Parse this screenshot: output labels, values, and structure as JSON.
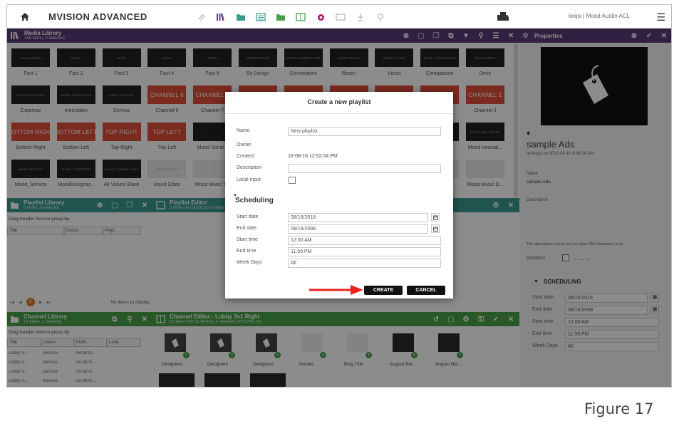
{
  "app": {
    "title": "MVISION ADVANCED",
    "user": "leejsi | Mood Austin ACL"
  },
  "media_library": {
    "title": "Media Library",
    "subtitle": "185 items, 0 selected",
    "rows": [
      [
        {
          "label": "Fact 1",
          "tile": "MOOD MEDIA",
          "style": "dark"
        },
        {
          "label": "Fact 2",
          "tile": "MOOD",
          "style": "dark"
        },
        {
          "label": "Fact 3",
          "tile": "MOOD",
          "style": "dark"
        },
        {
          "label": "Fact 4",
          "tile": "MOOD",
          "style": "dark"
        },
        {
          "label": "Fact 5",
          "tile": "MOOD",
          "style": "dark"
        },
        {
          "label": "By Design",
          "tile": "MOOD DESIGN",
          "style": "dark"
        },
        {
          "label": "Connections",
          "tile": "MOOD CONNECTIONS",
          "style": "dark"
        },
        {
          "label": "Reach",
          "tile": "MOOD REACH",
          "style": "dark"
        },
        {
          "label": "Vision",
          "tile": "MOOD VISION",
          "style": "dark"
        },
        {
          "label": "Compassion",
          "tile": "MOOD COMPASSION",
          "style": "dark"
        },
        {
          "label": "Drive",
          "tile": "MOOD DRIVE",
          "style": "dark"
        }
      ],
      [
        {
          "label": "Expertise",
          "tile": "MOOD EXPERTISE",
          "style": "dark"
        },
        {
          "label": "Innovation",
          "tile": "MOOD INNOVATION",
          "style": "dark"
        },
        {
          "label": "Service",
          "tile": "MOOD SERVICE",
          "style": "dark"
        },
        {
          "label": "Channel-6",
          "tile": "CHANNEL 6",
          "style": "red"
        },
        {
          "label": "Channel-7",
          "tile": "CHANNEL 7",
          "style": "red"
        },
        {
          "label": "",
          "tile": "",
          "style": "red"
        },
        {
          "label": "",
          "tile": "",
          "style": "red"
        },
        {
          "label": "",
          "tile": "",
          "style": "red"
        },
        {
          "label": "",
          "tile": "",
          "style": "red"
        },
        {
          "label": "",
          "tile": "",
          "style": "red"
        },
        {
          "label": "Channel-1",
          "tile": "CHANNEL 1",
          "style": "red"
        }
      ],
      [
        {
          "label": "Bottom-Right",
          "tile": "BOTTOM RIGHT",
          "style": "red"
        },
        {
          "label": "Bottom-Left",
          "tile": "BOTTOM LEFT",
          "style": "red"
        },
        {
          "label": "Top-Right",
          "tile": "TOP RIGHT",
          "style": "red"
        },
        {
          "label": "Top-Left",
          "tile": "TOP LEFT",
          "style": "red"
        },
        {
          "label": "Mood Soluti...",
          "tile": "",
          "style": "dark"
        },
        {
          "label": "",
          "tile": "",
          "style": "dark"
        },
        {
          "label": "",
          "tile": "",
          "style": "dark"
        },
        {
          "label": "",
          "tile": "",
          "style": "dark"
        },
        {
          "label": "",
          "tile": "",
          "style": "dark"
        },
        {
          "label": "",
          "tile": "",
          "style": "dark"
        },
        {
          "label": "Mood Innovat...",
          "tile": "MOOD INNOVATION",
          "style": "dark"
        }
      ],
      [
        {
          "label": "Mood_Service",
          "tile": "MOOD SERVICE",
          "style": "dark"
        },
        {
          "label": "MoodDesigner...",
          "tile": "MOOD EXPERTISE",
          "style": "dark"
        },
        {
          "label": "All Values Black",
          "tile": "MOOD CONNECTIONS",
          "style": "dark"
        },
        {
          "label": "Mood Cities",
          "tile": "MOOD CITIES",
          "style": "dim"
        },
        {
          "label": "Mood Music T...",
          "tile": "",
          "style": "dim"
        },
        {
          "label": "",
          "tile": "",
          "style": "dim"
        },
        {
          "label": "",
          "tile": "",
          "style": "dim"
        },
        {
          "label": "",
          "tile": "",
          "style": "dim"
        },
        {
          "label": "",
          "tile": "",
          "style": "dim"
        },
        {
          "label": "",
          "tile": "",
          "style": "dim"
        },
        {
          "label": "Mood Music D...",
          "tile": "",
          "style": "dim"
        }
      ]
    ]
  },
  "playlist_library": {
    "title": "Playlist Library",
    "subtitle": "0 items, 0 selected",
    "group_hint": "Drag header here to group by",
    "columns": [
      "Title",
      "Descri...",
      "Playl..."
    ],
    "page": "0",
    "empty": "No items to display"
  },
  "playlist_editor": {
    "title": "Playlist Editor",
    "subtitle": "0 items (00:00:00.00) 0 selected"
  },
  "channel_library": {
    "title": "Channel Library",
    "subtitle": "14 items, 1 selected",
    "group_hint": "Drag header here to group by",
    "columns": [
      "Title",
      "Owner",
      "Publi...",
      "Lock..."
    ],
    "rows": [
      [
        "Lobby V...",
        "joehuse",
        "05/18/20...",
        ""
      ],
      [
        "Lobby V...",
        "joehuse",
        "05/18/20...",
        ""
      ],
      [
        "Lobby V...",
        "joehuse",
        "05/18/20...",
        ""
      ],
      [
        "Lobby V...",
        "mahuse",
        "05/18/20...",
        ""
      ]
    ]
  },
  "channel_editor": {
    "title": "Channel Editor - Lobby 3v1 Right",
    "subtitle": "10 items (00:01:48.443) 0 selected (00:00:00.00)",
    "items": [
      {
        "label": "Designers",
        "badge": "1"
      },
      {
        "label": "Designers",
        "badge": "2"
      },
      {
        "label": "Designers",
        "badge": "3"
      },
      {
        "label": "Socials",
        "badge": "4"
      },
      {
        "label": "Blog Title",
        "badge": "5"
      },
      {
        "label": "August Bet...",
        "badge": "6"
      },
      {
        "label": "August Bet...",
        "badge": "7"
      }
    ]
  },
  "properties": {
    "title": "Properties",
    "name": "sample Ads",
    "byline": "by leejsi on 2016-08-16 4:36:34 PM",
    "name_label": "Name",
    "name_value": "sample Ads",
    "desc_label": "Description",
    "desc_hint": "The description has to be less than 255 characters long",
    "duration_label": "Duration",
    "duration_value": "_ : _ : _",
    "scheduling_label": "SCHEDULING",
    "start_date_label": "Start date",
    "start_date": "08/16/2016",
    "end_date_label": "End date",
    "end_date": "08/16/2099",
    "start_time_label": "Start time",
    "start_time": "12:00 AM",
    "end_time_label": "End time",
    "end_time": "11:59 PM",
    "week_days_label": "Week Days",
    "week_days": "All"
  },
  "modal": {
    "title": "Create a new playlist",
    "name_label": "Name",
    "name_value": "New playlist",
    "owner_label": "Owner",
    "created_label": "Created",
    "created_value": "16-08-16 12:52:04 PM",
    "description_label": "Description",
    "local_input_label": "Local input",
    "scheduling_label": "Scheduling",
    "start_date_label": "Start date",
    "start_date": "08/16/2016",
    "end_date_label": "End date",
    "end_date": "08/16/2099",
    "start_time_label": "Start time",
    "start_time": "12:00 AM",
    "end_time_label": "End time",
    "end_time": "11:59 PM",
    "week_days_label": "Week Days",
    "week_days": "All",
    "create_label": "CREATE",
    "cancel_label": "CANCEL"
  },
  "caption": "Figure 17",
  "colors": {
    "media_header": "#5c3b7a",
    "playlist_header": "#3a9c8f",
    "channel_header": "#4aa04a",
    "arrow": "#e8231d"
  }
}
